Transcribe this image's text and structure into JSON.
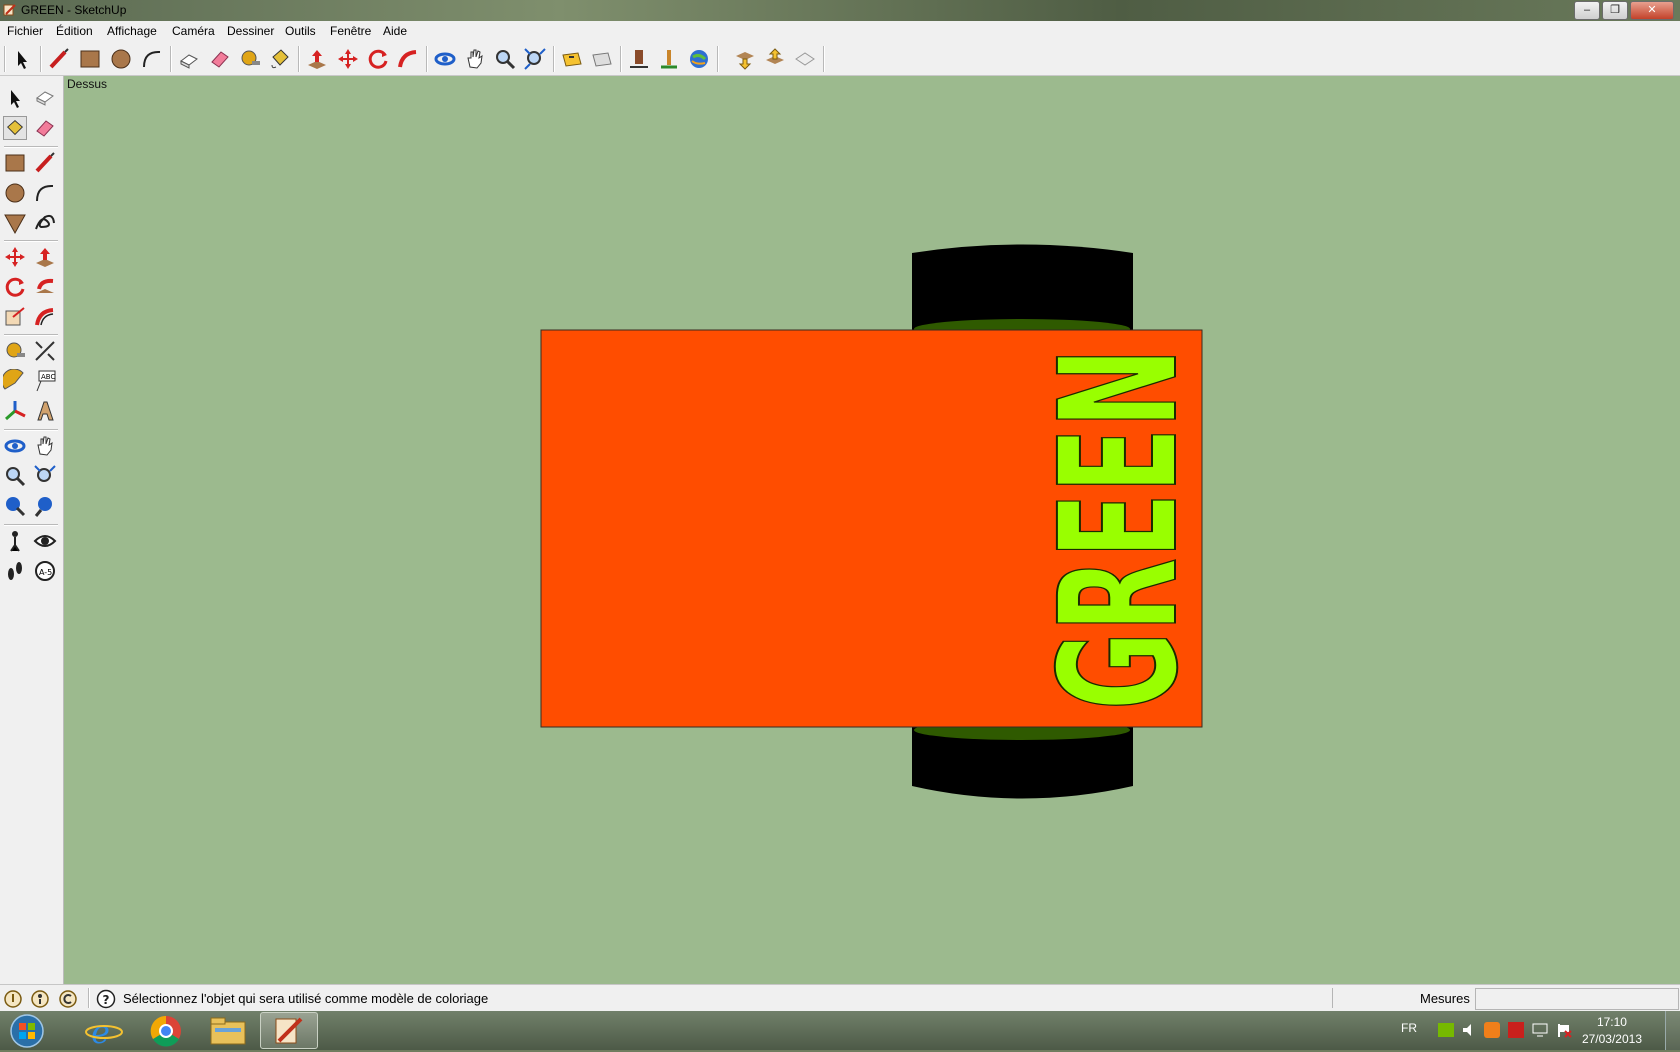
{
  "window": {
    "title": "GREEN - SketchUp",
    "controls": {
      "minimize": "–",
      "maximize": "❐",
      "close": "✕"
    }
  },
  "menu": [
    "Fichier",
    "Édition",
    "Affichage",
    "Caméra",
    "Dessiner",
    "Outils",
    "Fenêtre",
    "Aide"
  ],
  "toolbar": {
    "icons": [
      "select-icon",
      "line-icon",
      "rectangle-icon",
      "circle-icon",
      "arc-icon",
      "make-component-icon",
      "eraser-icon",
      "tape-measure-icon",
      "paint-bucket-icon",
      "push-pull-icon",
      "move-icon",
      "rotate-icon",
      "follow-me-icon",
      "orbit-icon",
      "pan-icon",
      "zoom-icon",
      "zoom-extents-icon",
      "3d-warehouse-get-icon",
      "share-model-icon",
      "get-photo-texture-icon",
      "add-location-icon",
      "google-earth-icon",
      "get-models-icon",
      "share-component-icon",
      "dynamic-component-icon"
    ]
  },
  "viewport": {
    "view_label": "Dessus",
    "background": "#9cba8e"
  },
  "model": {
    "panel_text": "GREEN",
    "panel_color": "#ff4d00",
    "text_color": "#99ff00",
    "wheel_color": "#000000",
    "axle_color": "#2f5a00"
  },
  "status": {
    "message": "Sélectionnez l'objet qui sera utilisé comme modèle de coloriage",
    "measure_label": "Mesures",
    "measure_value": ""
  },
  "taskbar": {
    "language": "FR",
    "time": "17:10",
    "date": "27/03/2013"
  }
}
